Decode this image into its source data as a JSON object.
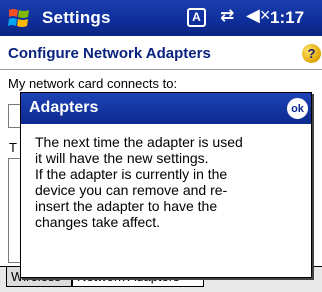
{
  "titlebar": {
    "title": "Settings",
    "tray_a": "A",
    "connectivity_glyph": "⇄",
    "volume_glyph": "◀×",
    "time": "1:17"
  },
  "header": {
    "title": "Configure Network Adapters",
    "help_glyph": "?"
  },
  "background": {
    "label": "My network card connects to:",
    "partial_letter": "T"
  },
  "tabs": [
    {
      "label": "Wireless"
    },
    {
      "label": "Network Adapters"
    }
  ],
  "dialog": {
    "title": "Adapters",
    "ok_label": "ok",
    "lines": [
      "The next time the adapter is used",
      "it will have the new settings.",
      "If the adapter is currently in the",
      "device you can remove and re-",
      "insert the adapter to have the",
      "changes take affect."
    ]
  },
  "colors": {
    "titlebar": "#0f2f9c",
    "header_text": "#0a237e",
    "dialog_title": "#1d43b6"
  },
  "icons": {
    "start": "windows-flag-icon",
    "help": "help-icon",
    "ok": "ok-icon"
  }
}
